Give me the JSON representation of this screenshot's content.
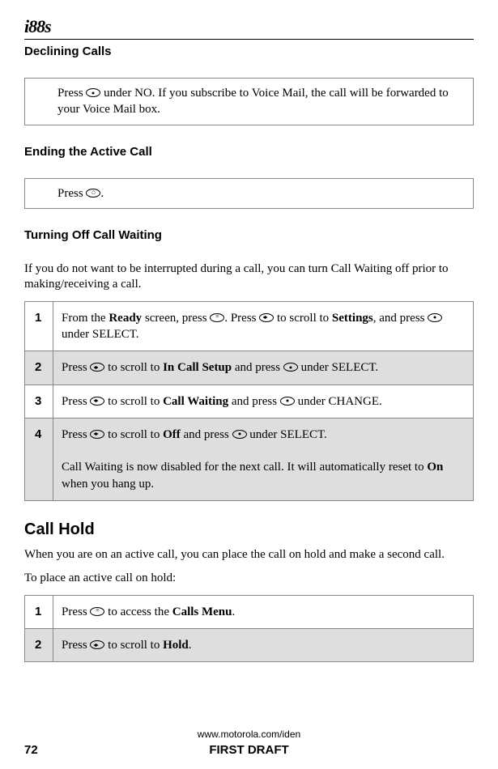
{
  "logo": "i88s",
  "page_title": "Declining Calls",
  "box1": {
    "pre": "Press ",
    "post": " under NO. If you subscribe to Voice Mail, the call will be forwarded to your Voice Mail box."
  },
  "ending_title": "Ending the Active Call",
  "box2": {
    "pre": "Press ",
    "post": "."
  },
  "turning_off_title": "Turning Off Call Waiting",
  "turning_off_intro": "If you do not want to be interrupted during a call, you can turn Call Waiting off prior to making/receiving a call.",
  "steps1": [
    {
      "num": "1",
      "parts": [
        "From the ",
        "Ready",
        " screen, press ",
        "MENU_ICON",
        ". Press ",
        "SCROLL_ICON",
        " to scroll to ",
        "Settings",
        ", and press ",
        "DOT_ICON",
        " under SELECT."
      ]
    },
    {
      "num": "2",
      "parts": [
        "Press ",
        "SCROLL_ICON",
        " to scroll to ",
        "In Call Setup",
        " and press ",
        "DOT_ICON",
        " under SELECT."
      ]
    },
    {
      "num": "3",
      "parts": [
        "Press ",
        "SCROLL_ICON",
        " to scroll to ",
        "Call Waiting",
        " and press ",
        "DOT_ICON",
        " under CHANGE."
      ]
    },
    {
      "num": "4",
      "parts": [
        "Press ",
        "SCROLL_ICON",
        " to scroll to ",
        "Off",
        " and press ",
        "DOT_ICON",
        " under SELECT."
      ],
      "extra": [
        "Call Waiting is now disabled for the next call. It will automatically reset to ",
        "On",
        " when you hang up."
      ]
    }
  ],
  "call_hold_title": "Call Hold",
  "call_hold_intro1": "When you are on an active call, you can place the call on hold and make a second call.",
  "call_hold_intro2": "To place an active call on hold:",
  "steps2": [
    {
      "num": "1",
      "parts": [
        "Press ",
        "MENU_ICON",
        " to access the ",
        "Calls Menu",
        "."
      ]
    },
    {
      "num": "2",
      "parts": [
        "Press ",
        "SCROLL_ICON",
        " to scroll to ",
        "Hold",
        "."
      ]
    }
  ],
  "footer_url": "www.motorola.com/iden",
  "page_num": "72",
  "draft": "FIRST DRAFT"
}
